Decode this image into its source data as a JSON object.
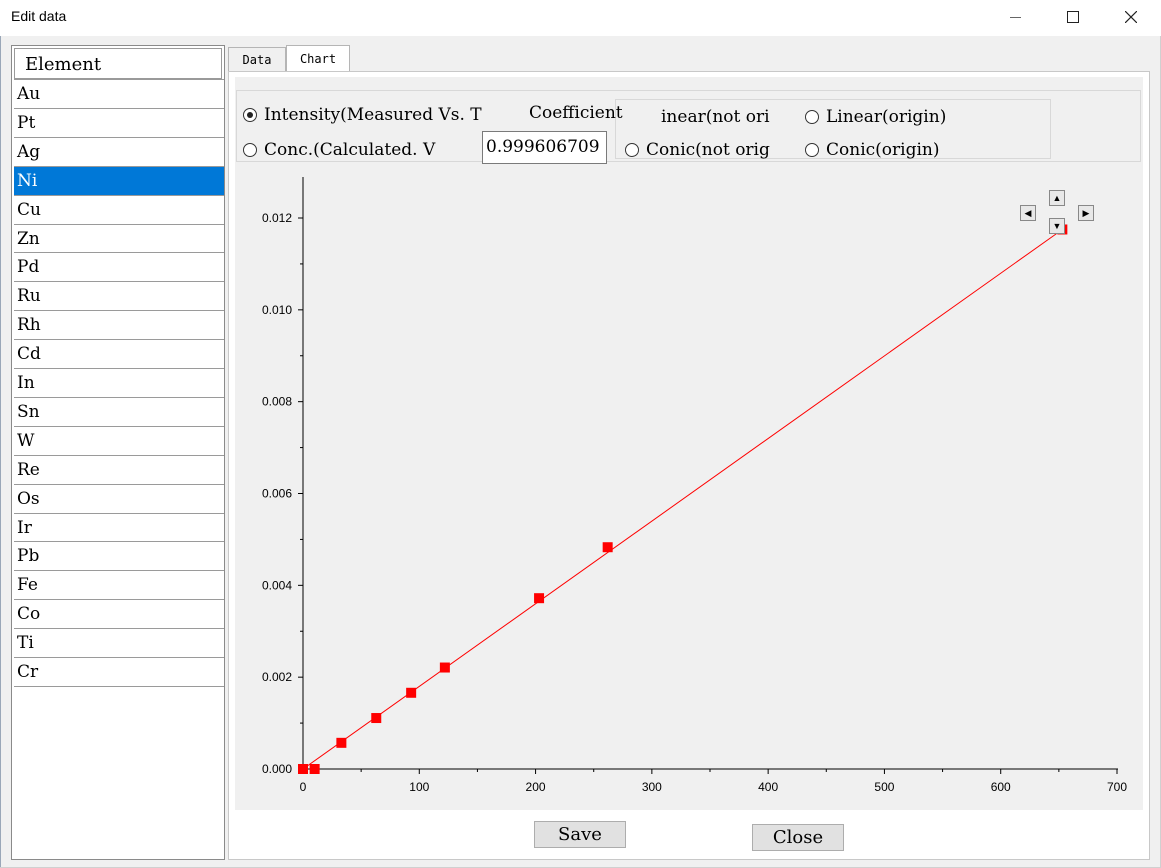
{
  "window": {
    "title": "Edit data",
    "minimize_icon": "minimize-icon",
    "maximize_icon": "maximize-icon",
    "close_icon": "close-icon"
  },
  "element_list": {
    "header": "Element",
    "selected": "Ni",
    "items": [
      "Au",
      "Pt",
      "Ag",
      "Ni",
      "Cu",
      "Zn",
      "Pd",
      "Ru",
      "Rh",
      "Cd",
      "In",
      "Sn",
      "W",
      "Re",
      "Os",
      "Ir",
      "Pb",
      "Fe",
      "Co",
      "Ti",
      "Cr"
    ]
  },
  "tabs": [
    {
      "label": "Data",
      "active": false
    },
    {
      "label": "Chart",
      "active": true
    }
  ],
  "options": {
    "intensity_label": "Intensity(Measured Vs. T",
    "conc_label": "Conc.(Calculated. V",
    "coefficient_label": "Coefficient",
    "coefficient_value": "0.999606709",
    "linear_not_origin_label": "inear(not ori",
    "linear_origin_label": "Linear(origin)",
    "conic_not_origin_label": "Conic(not orig",
    "conic_origin_label": "Conic(origin)"
  },
  "chart_data": {
    "type": "line",
    "series": [
      {
        "values": [
          [
            0,
            0
          ],
          [
            10,
            0
          ],
          [
            33,
            0.00057
          ],
          [
            63,
            0.00111
          ],
          [
            93,
            0.00166
          ],
          [
            122,
            0.00221
          ],
          [
            203,
            0.00372
          ],
          [
            262,
            0.00483
          ],
          [
            653,
            0.01175
          ]
        ],
        "fit_line": [
          [
            0,
            0
          ],
          [
            653,
            0.01175
          ]
        ],
        "color": "#ff0000"
      }
    ],
    "xlim": [
      0,
      700
    ],
    "ylim": [
      0,
      0.013
    ],
    "xticks": [
      "0",
      "100",
      "200",
      "300",
      "400",
      "500",
      "600",
      "700"
    ],
    "yticks": [
      "0.000",
      "0.002",
      "0.004",
      "0.006",
      "0.008",
      "0.010",
      "0.012"
    ],
    "grid": false
  },
  "buttons": {
    "save_label": "Save",
    "close_label": "Close"
  }
}
